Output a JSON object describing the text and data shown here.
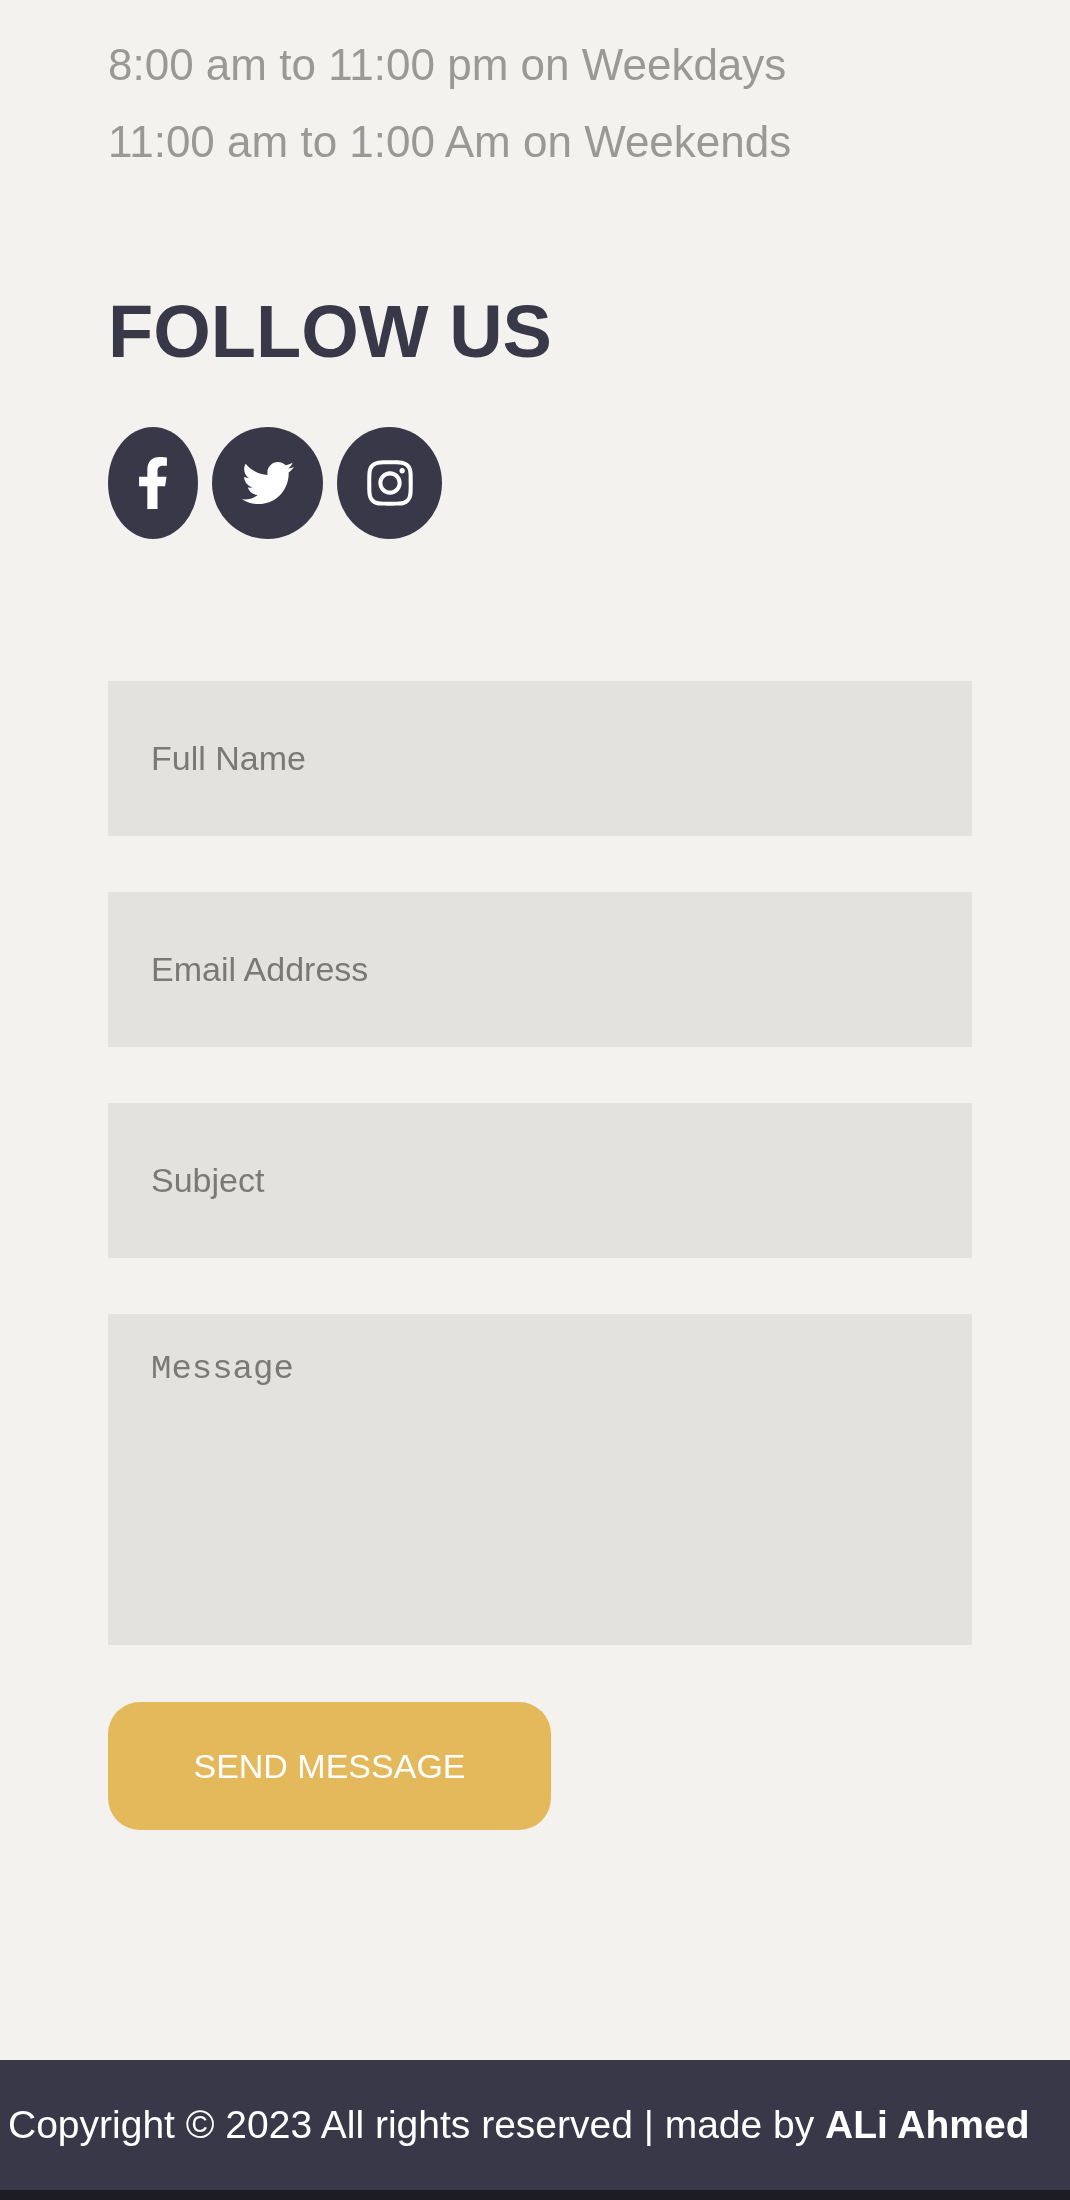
{
  "hours": [
    "8:00 am to 11:00 pm on Weekdays",
    "11:00 am to 1:00 Am on Weekends"
  ],
  "follow": {
    "title": "FOLLOW US",
    "links": [
      {
        "kind": "facebook"
      },
      {
        "kind": "twitter"
      },
      {
        "kind": "instagram"
      }
    ]
  },
  "form": {
    "fields": [
      {
        "kind": "input",
        "placeholder": "Full Name"
      },
      {
        "kind": "input",
        "placeholder": "Email Address"
      },
      {
        "kind": "input",
        "placeholder": "Subject"
      },
      {
        "kind": "textarea",
        "placeholder": "Message"
      }
    ],
    "submit": "SEND MESSAGE"
  },
  "footer": {
    "text": "Copyright © 2023 All rights reserved | made by **ALi Ahmed**"
  }
}
